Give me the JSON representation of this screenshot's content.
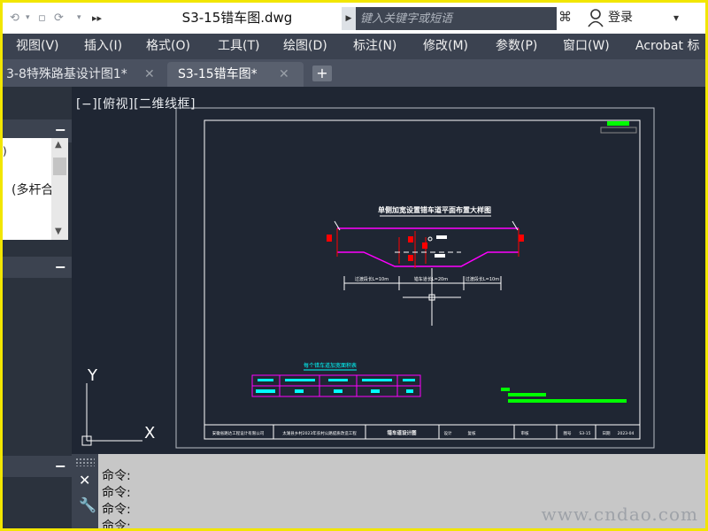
{
  "title_bar": {
    "file_title": "S3-15错车图.dwg",
    "search_placeholder": "键入关键字或短语",
    "login_label": "登录"
  },
  "menu": {
    "items": [
      "视图(V)",
      "插入(I)",
      "格式(O)",
      "工具(T)",
      "绘图(D)",
      "标注(N)",
      "修改(M)",
      "参数(P)",
      "窗口(W)",
      "Acrobat 标"
    ]
  },
  "tabs": [
    {
      "label": "3-8特殊路基设计图1*",
      "active": false
    },
    {
      "label": "S3-15错车图*",
      "active": true
    }
  ],
  "panels": {
    "panel1_item": "(多杆合",
    "panel1_marker": ")"
  },
  "viewport": {
    "view_label": "[−][俯视][二维线框]",
    "background": "#1f2633",
    "drawing": {
      "main_title": "单侧加宽设置错车道平面布置大样图",
      "dim_left": "过渡段长L=10m",
      "dim_mid": "错车道长L=20m",
      "dim_right": "过渡段长L=10m",
      "table_title": "每个错车道加宽面积表",
      "footer": {
        "org": "安徽省路达工程设计有限公司",
        "project": "太湖县乡村2023年农村公路提质改造工程",
        "drawing_name": "错车道设计图",
        "design": "设计",
        "check": "复核",
        "review": "审核",
        "number_label": "图号",
        "number": "S3-15",
        "date_label": "日期",
        "date": "2023-04"
      }
    }
  },
  "ucs": {
    "x_label": "X",
    "y_label": "Y"
  },
  "command_lines": [
    "命令:",
    "命令:",
    "命令:",
    "命令:"
  ],
  "watermark": "www.cndao.com",
  "colors": {
    "frame": "#f2e600",
    "magenta": "#ff00ff",
    "red": "#ff0000",
    "cyan": "#00ffff",
    "green": "#00ff00"
  }
}
